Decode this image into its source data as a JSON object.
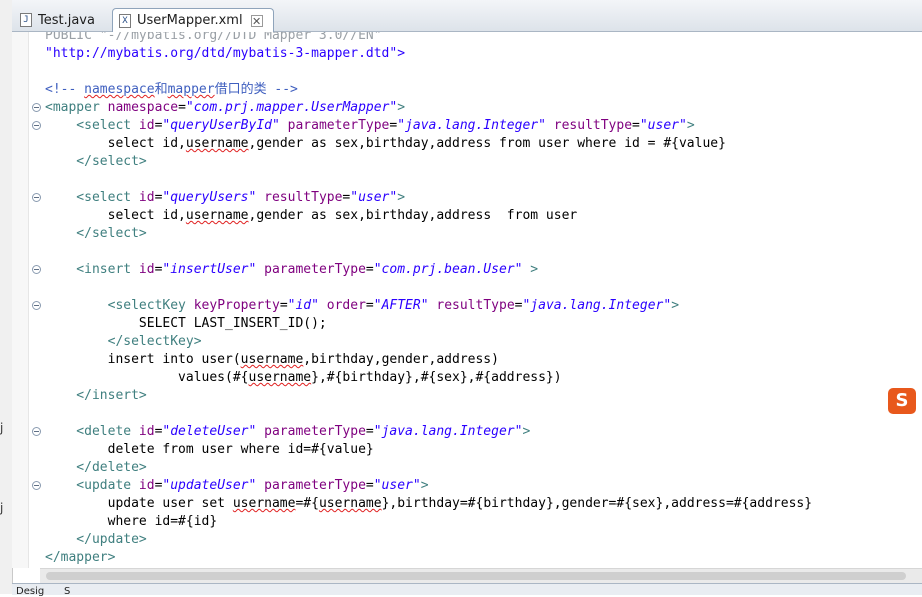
{
  "tabs": [
    {
      "label": "Test.java",
      "icon": "java-file-icon",
      "active": false
    },
    {
      "label": "UserMapper.xml",
      "icon": "xml-file-icon",
      "active": true
    }
  ],
  "left_strip_fragments": [
    "j",
    "j"
  ],
  "code_lines": [
    [
      {
        "t": "PUBLIC \"-//mybatis.org//DTD Mapper 3.0//EN\"",
        "c": "faded"
      }
    ],
    [
      {
        "t": "\"http://mybatis.org/dtd/mybatis-3-mapper.dtd\">",
        "c": "str"
      }
    ],
    [],
    [
      {
        "t": "<!-- ",
        "c": "cmt"
      },
      {
        "t": "namespace",
        "c": "cmt sq"
      },
      {
        "t": "和",
        "c": "cmt"
      },
      {
        "t": "mapper",
        "c": "cmt sq"
      },
      {
        "t": "借口的类 -->",
        "c": "cmt"
      }
    ],
    [
      {
        "t": "<mapper ",
        "c": "tag"
      },
      {
        "t": "namespace",
        "c": "attr"
      },
      {
        "t": "=",
        "c": ""
      },
      {
        "t": "\"com.prj.mapper.UserMapper\"",
        "c": "val"
      },
      {
        "t": ">",
        "c": "tag"
      }
    ],
    [
      {
        "t": "    <select ",
        "c": "tag"
      },
      {
        "t": "id",
        "c": "attr"
      },
      {
        "t": "=",
        "c": ""
      },
      {
        "t": "\"queryUserById\"",
        "c": "val"
      },
      {
        "t": " parameterType",
        "c": "attr"
      },
      {
        "t": "=",
        "c": ""
      },
      {
        "t": "\"java.lang.Integer\"",
        "c": "val"
      },
      {
        "t": " resultType",
        "c": "attr"
      },
      {
        "t": "=",
        "c": ""
      },
      {
        "t": "\"user\"",
        "c": "val"
      },
      {
        "t": ">",
        "c": "tag"
      }
    ],
    [
      {
        "t": "        select id,",
        "c": ""
      },
      {
        "t": "username",
        "c": "sq"
      },
      {
        "t": ",gender as sex,birthday,address from user where id = #{value}",
        "c": ""
      }
    ],
    [
      {
        "t": "    </select>",
        "c": "tag"
      }
    ],
    [],
    [
      {
        "t": "    <select ",
        "c": "tag"
      },
      {
        "t": "id",
        "c": "attr"
      },
      {
        "t": "=",
        "c": ""
      },
      {
        "t": "\"queryUsers\"",
        "c": "val"
      },
      {
        "t": " resultType",
        "c": "attr"
      },
      {
        "t": "=",
        "c": ""
      },
      {
        "t": "\"user\"",
        "c": "val"
      },
      {
        "t": ">",
        "c": "tag"
      }
    ],
    [
      {
        "t": "        select id,",
        "c": ""
      },
      {
        "t": "username",
        "c": "sq"
      },
      {
        "t": ",gender as sex,birthday,address  from user",
        "c": ""
      }
    ],
    [
      {
        "t": "    </select>",
        "c": "tag"
      }
    ],
    [],
    [
      {
        "t": "    <insert ",
        "c": "tag"
      },
      {
        "t": "id",
        "c": "attr"
      },
      {
        "t": "=",
        "c": ""
      },
      {
        "t": "\"insertUser\"",
        "c": "val"
      },
      {
        "t": " parameterType",
        "c": "attr"
      },
      {
        "t": "=",
        "c": ""
      },
      {
        "t": "\"com.prj.bean.User\"",
        "c": "val"
      },
      {
        "t": " >",
        "c": "tag"
      }
    ],
    [],
    [
      {
        "t": "        <selectKey ",
        "c": "tag"
      },
      {
        "t": "keyProperty",
        "c": "attr"
      },
      {
        "t": "=",
        "c": ""
      },
      {
        "t": "\"id\"",
        "c": "val"
      },
      {
        "t": " order",
        "c": "attr"
      },
      {
        "t": "=",
        "c": ""
      },
      {
        "t": "\"AFTER\"",
        "c": "val"
      },
      {
        "t": " resultType",
        "c": "attr"
      },
      {
        "t": "=",
        "c": ""
      },
      {
        "t": "\"java.lang.Integer\"",
        "c": "val"
      },
      {
        "t": ">",
        "c": "tag"
      }
    ],
    [
      {
        "t": "            SELECT LAST_INSERT_ID();",
        "c": ""
      }
    ],
    [
      {
        "t": "        </selectKey>",
        "c": "tag"
      }
    ],
    [
      {
        "t": "        insert into user(",
        "c": ""
      },
      {
        "t": "username",
        "c": "sq"
      },
      {
        "t": ",birthday,gender,address)",
        "c": ""
      }
    ],
    [
      {
        "t": "                 values(#{",
        "c": ""
      },
      {
        "t": "username",
        "c": "sq"
      },
      {
        "t": "},#{birthday},#{sex},#{address})",
        "c": ""
      }
    ],
    [
      {
        "t": "    </insert>",
        "c": "tag"
      }
    ],
    [],
    [
      {
        "t": "    <delete ",
        "c": "tag"
      },
      {
        "t": "id",
        "c": "attr"
      },
      {
        "t": "=",
        "c": ""
      },
      {
        "t": "\"deleteUser\"",
        "c": "val"
      },
      {
        "t": " parameterType",
        "c": "attr"
      },
      {
        "t": "=",
        "c": ""
      },
      {
        "t": "\"java.lang.Integer\"",
        "c": "val"
      },
      {
        "t": ">",
        "c": "tag"
      }
    ],
    [
      {
        "t": "        delete from user where id=#{value}",
        "c": ""
      }
    ],
    [
      {
        "t": "    </delete>",
        "c": "tag"
      }
    ],
    [
      {
        "t": "    <update ",
        "c": "tag"
      },
      {
        "t": "id",
        "c": "attr"
      },
      {
        "t": "=",
        "c": ""
      },
      {
        "t": "\"updateUser\"",
        "c": "val"
      },
      {
        "t": " parameterType",
        "c": "attr"
      },
      {
        "t": "=",
        "c": ""
      },
      {
        "t": "\"user\"",
        "c": "val"
      },
      {
        "t": ">",
        "c": "tag"
      }
    ],
    [
      {
        "t": "        update user set ",
        "c": ""
      },
      {
        "t": "username",
        "c": "sq"
      },
      {
        "t": "=#{",
        "c": ""
      },
      {
        "t": "username",
        "c": "sq"
      },
      {
        "t": "},birthday=#{birthday},gender=#{sex},address=#{address}",
        "c": ""
      }
    ],
    [
      {
        "t": "        where id=#{id}",
        "c": ""
      }
    ],
    [
      {
        "t": "    </update>",
        "c": "tag"
      }
    ],
    [
      {
        "t": "</mapper>",
        "c": "tag"
      }
    ]
  ],
  "fold_lines": [
    4,
    5,
    9,
    13,
    15,
    22,
    25
  ],
  "bottom_tabs": [
    "Desig",
    "S"
  ],
  "ime_badge": {
    "label": "S",
    "icon": "sogou-ime-icon",
    "color": "#e8581c"
  }
}
